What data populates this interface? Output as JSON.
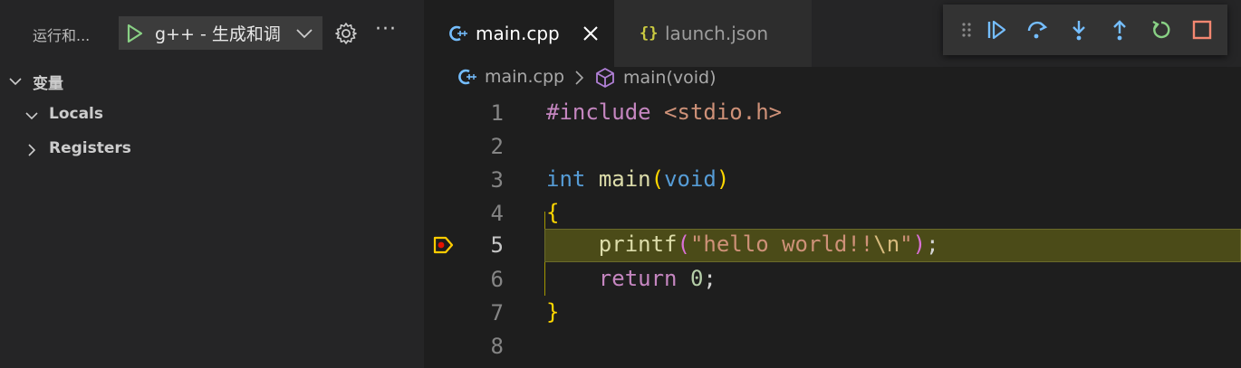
{
  "sidebar": {
    "title": "运行和...",
    "run_config": "g++ - 生成和调",
    "sections": [
      {
        "label": "变量"
      },
      {
        "label": "Locals"
      },
      {
        "label": "Registers"
      }
    ]
  },
  "tabs": [
    {
      "label": "main.cpp",
      "icon": "cpp-file-icon",
      "active": true
    },
    {
      "label": "launch.json",
      "icon": "json-file-icon",
      "active": false
    }
  ],
  "breadcrumb": {
    "file": "main.cpp",
    "symbol": "main(void)"
  },
  "debug_toolbar": [
    "drag-handle-icon",
    "continue-icon",
    "step-over-icon",
    "step-into-icon",
    "step-out-icon",
    "restart-icon",
    "stop-icon"
  ],
  "editor": {
    "current_line": 5,
    "lines": [
      {
        "n": "1"
      },
      {
        "n": "2"
      },
      {
        "n": "3"
      },
      {
        "n": "4"
      },
      {
        "n": "5"
      },
      {
        "n": "6"
      },
      {
        "n": "7"
      },
      {
        "n": "8"
      }
    ],
    "tokens": {
      "l1_dir": "#include",
      "l1_inc": "<stdio.h>",
      "l3_kw": "int",
      "l3_fn": "main",
      "l3_open": "(",
      "l3_void": "void",
      "l3_close": ")",
      "l4_brace": "{",
      "l5_fn": "printf",
      "l5_open": "(",
      "l5_str": "\"hello world!!",
      "l5_esc": "\\n",
      "l5_strend": "\"",
      "l5_close": ")",
      "l5_semi": ";",
      "l6_ret": "return",
      "l6_num": "0",
      "l6_semi": ";",
      "l7_brace": "}"
    }
  },
  "colors": {
    "background": "#1e1e1e",
    "sidebar": "#252526",
    "accent_blue": "#75beff",
    "debug_green": "#89d185",
    "stop_red": "#f48771",
    "breakpoint_yellow": "#ffcc00",
    "breakpoint_red": "#e51400"
  }
}
